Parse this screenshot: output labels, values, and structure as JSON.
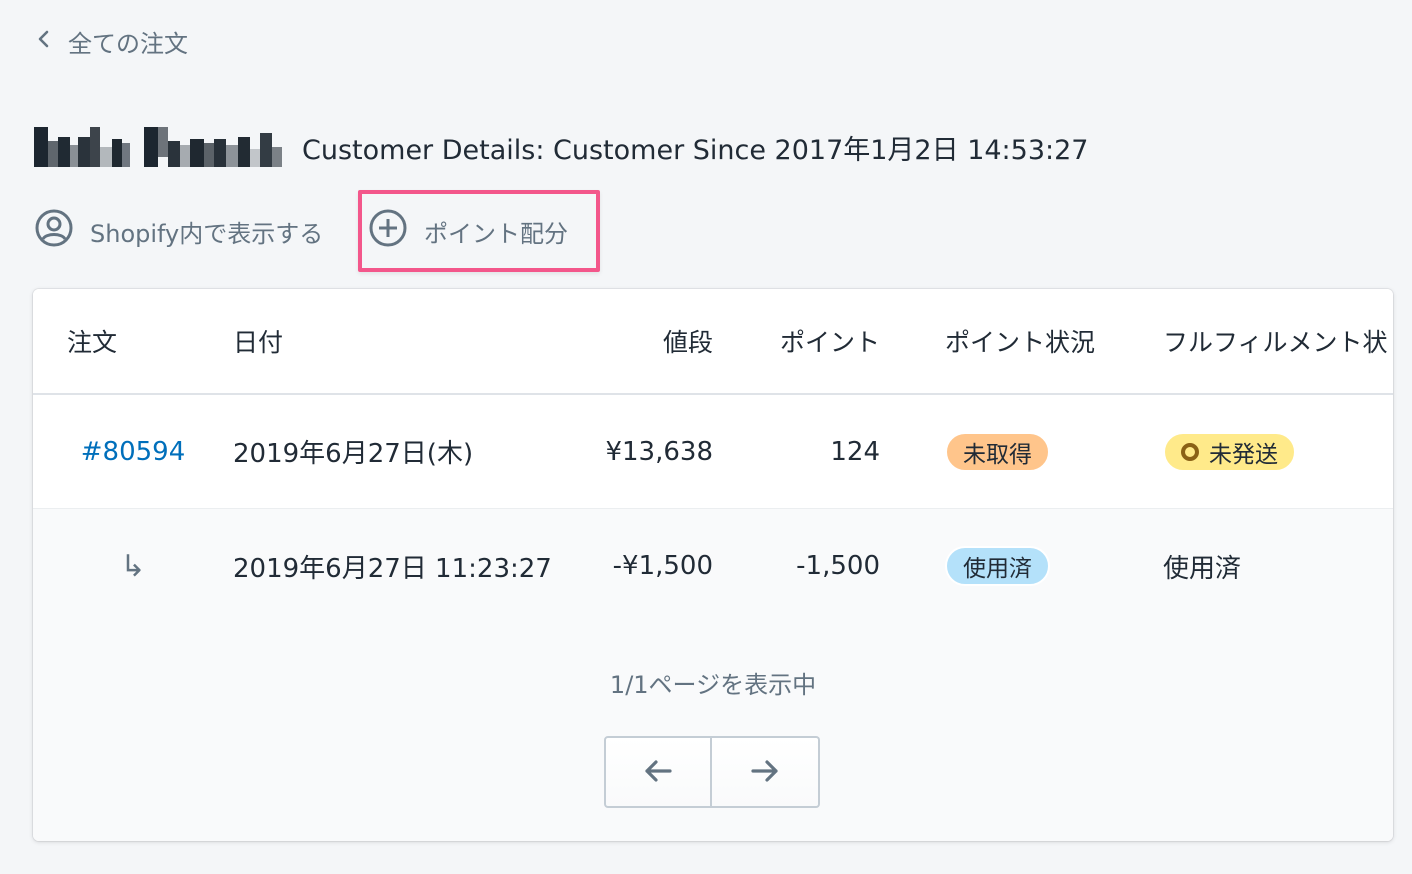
{
  "breadcrumb": {
    "label": "全ての注文",
    "icon": "chevron-left-icon"
  },
  "header": {
    "meta": "Customer Details: Customer Since 2017年1月2日 14:53:27"
  },
  "actions": {
    "view_in_shopify": "Shopify内で表示する",
    "allocate_points": "ポイント配分"
  },
  "table": {
    "columns": {
      "order": "注文",
      "date": "日付",
      "price": "値段",
      "points": "ポイント",
      "point_status": "ポイント状況",
      "fulfillment_status": "フルフィルメント状"
    },
    "rows": [
      {
        "order": "#80594",
        "date": "2019年6月27日(木)",
        "price": "¥13,638",
        "points": "124",
        "point_status": "未取得",
        "fulfillment_status": "未発送"
      },
      {
        "order": "↳",
        "date": "2019年6月27日 11:23:27",
        "price": "-¥1,500",
        "points": "-1,500",
        "point_status": "使用済",
        "fulfillment_status": "使用済"
      }
    ]
  },
  "pagination": {
    "info": "1/1ページを表示中",
    "prev_icon": "arrow-left-icon",
    "next_icon": "arrow-right-icon"
  },
  "colors": {
    "link": "#006fbb",
    "highlight_border": "#f3578b",
    "badge_unearned": "#ffc58b",
    "badge_used": "#b4e1fa",
    "badge_unfulfilled": "#ffea8a"
  }
}
